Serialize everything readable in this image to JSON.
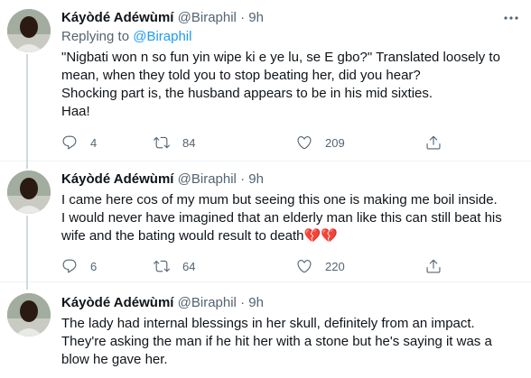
{
  "tweets": [
    {
      "name": "Káyòdé Adéwùmí",
      "handle": "@Biraphil",
      "dot": "·",
      "time": "9h",
      "replying_prefix": "Replying to ",
      "replying_to": "@Biraphil",
      "lines": [
        "\"Nigbati won n so fun yin wipe ki e ye lu, se E gbo?\" Translated loosely to",
        "mean, when they told you to stop beating her, did you hear?",
        "Shocking part is, the husband appears to be in his mid sixties.",
        "Haa!"
      ],
      "replies": "4",
      "retweets": "84",
      "likes": "209"
    },
    {
      "name": "Káyòdé Adéwùmí",
      "handle": "@Biraphil",
      "dot": "·",
      "time": "9h",
      "lines": [
        "I came here cos of my mum but seeing this one is making me boil inside.",
        "I would never have imagined that an elderly man like this can still beat his",
        "wife and the bating would result to death💔💔"
      ],
      "replies": "6",
      "retweets": "64",
      "likes": "220"
    },
    {
      "name": "Káyòdé Adéwùmí",
      "handle": "@Biraphil",
      "dot": "·",
      "time": "9h",
      "lines": [
        "The lady had internal blessings in her skull, definitely from an impact.",
        "They're asking the man if he hit her with a stone but he's saying it was a",
        "blow he gave her."
      ]
    }
  ],
  "icons": {
    "reply": "speech-bubble-icon",
    "retweet": "retweet-arrows-icon",
    "like": "heart-outline-icon",
    "share": "share-upload-icon",
    "more": "more-dots-icon"
  },
  "colors": {
    "link": "#1d9bf0",
    "muted": "#536471",
    "text": "#0f1419",
    "thread_line": "#cfd9de"
  }
}
